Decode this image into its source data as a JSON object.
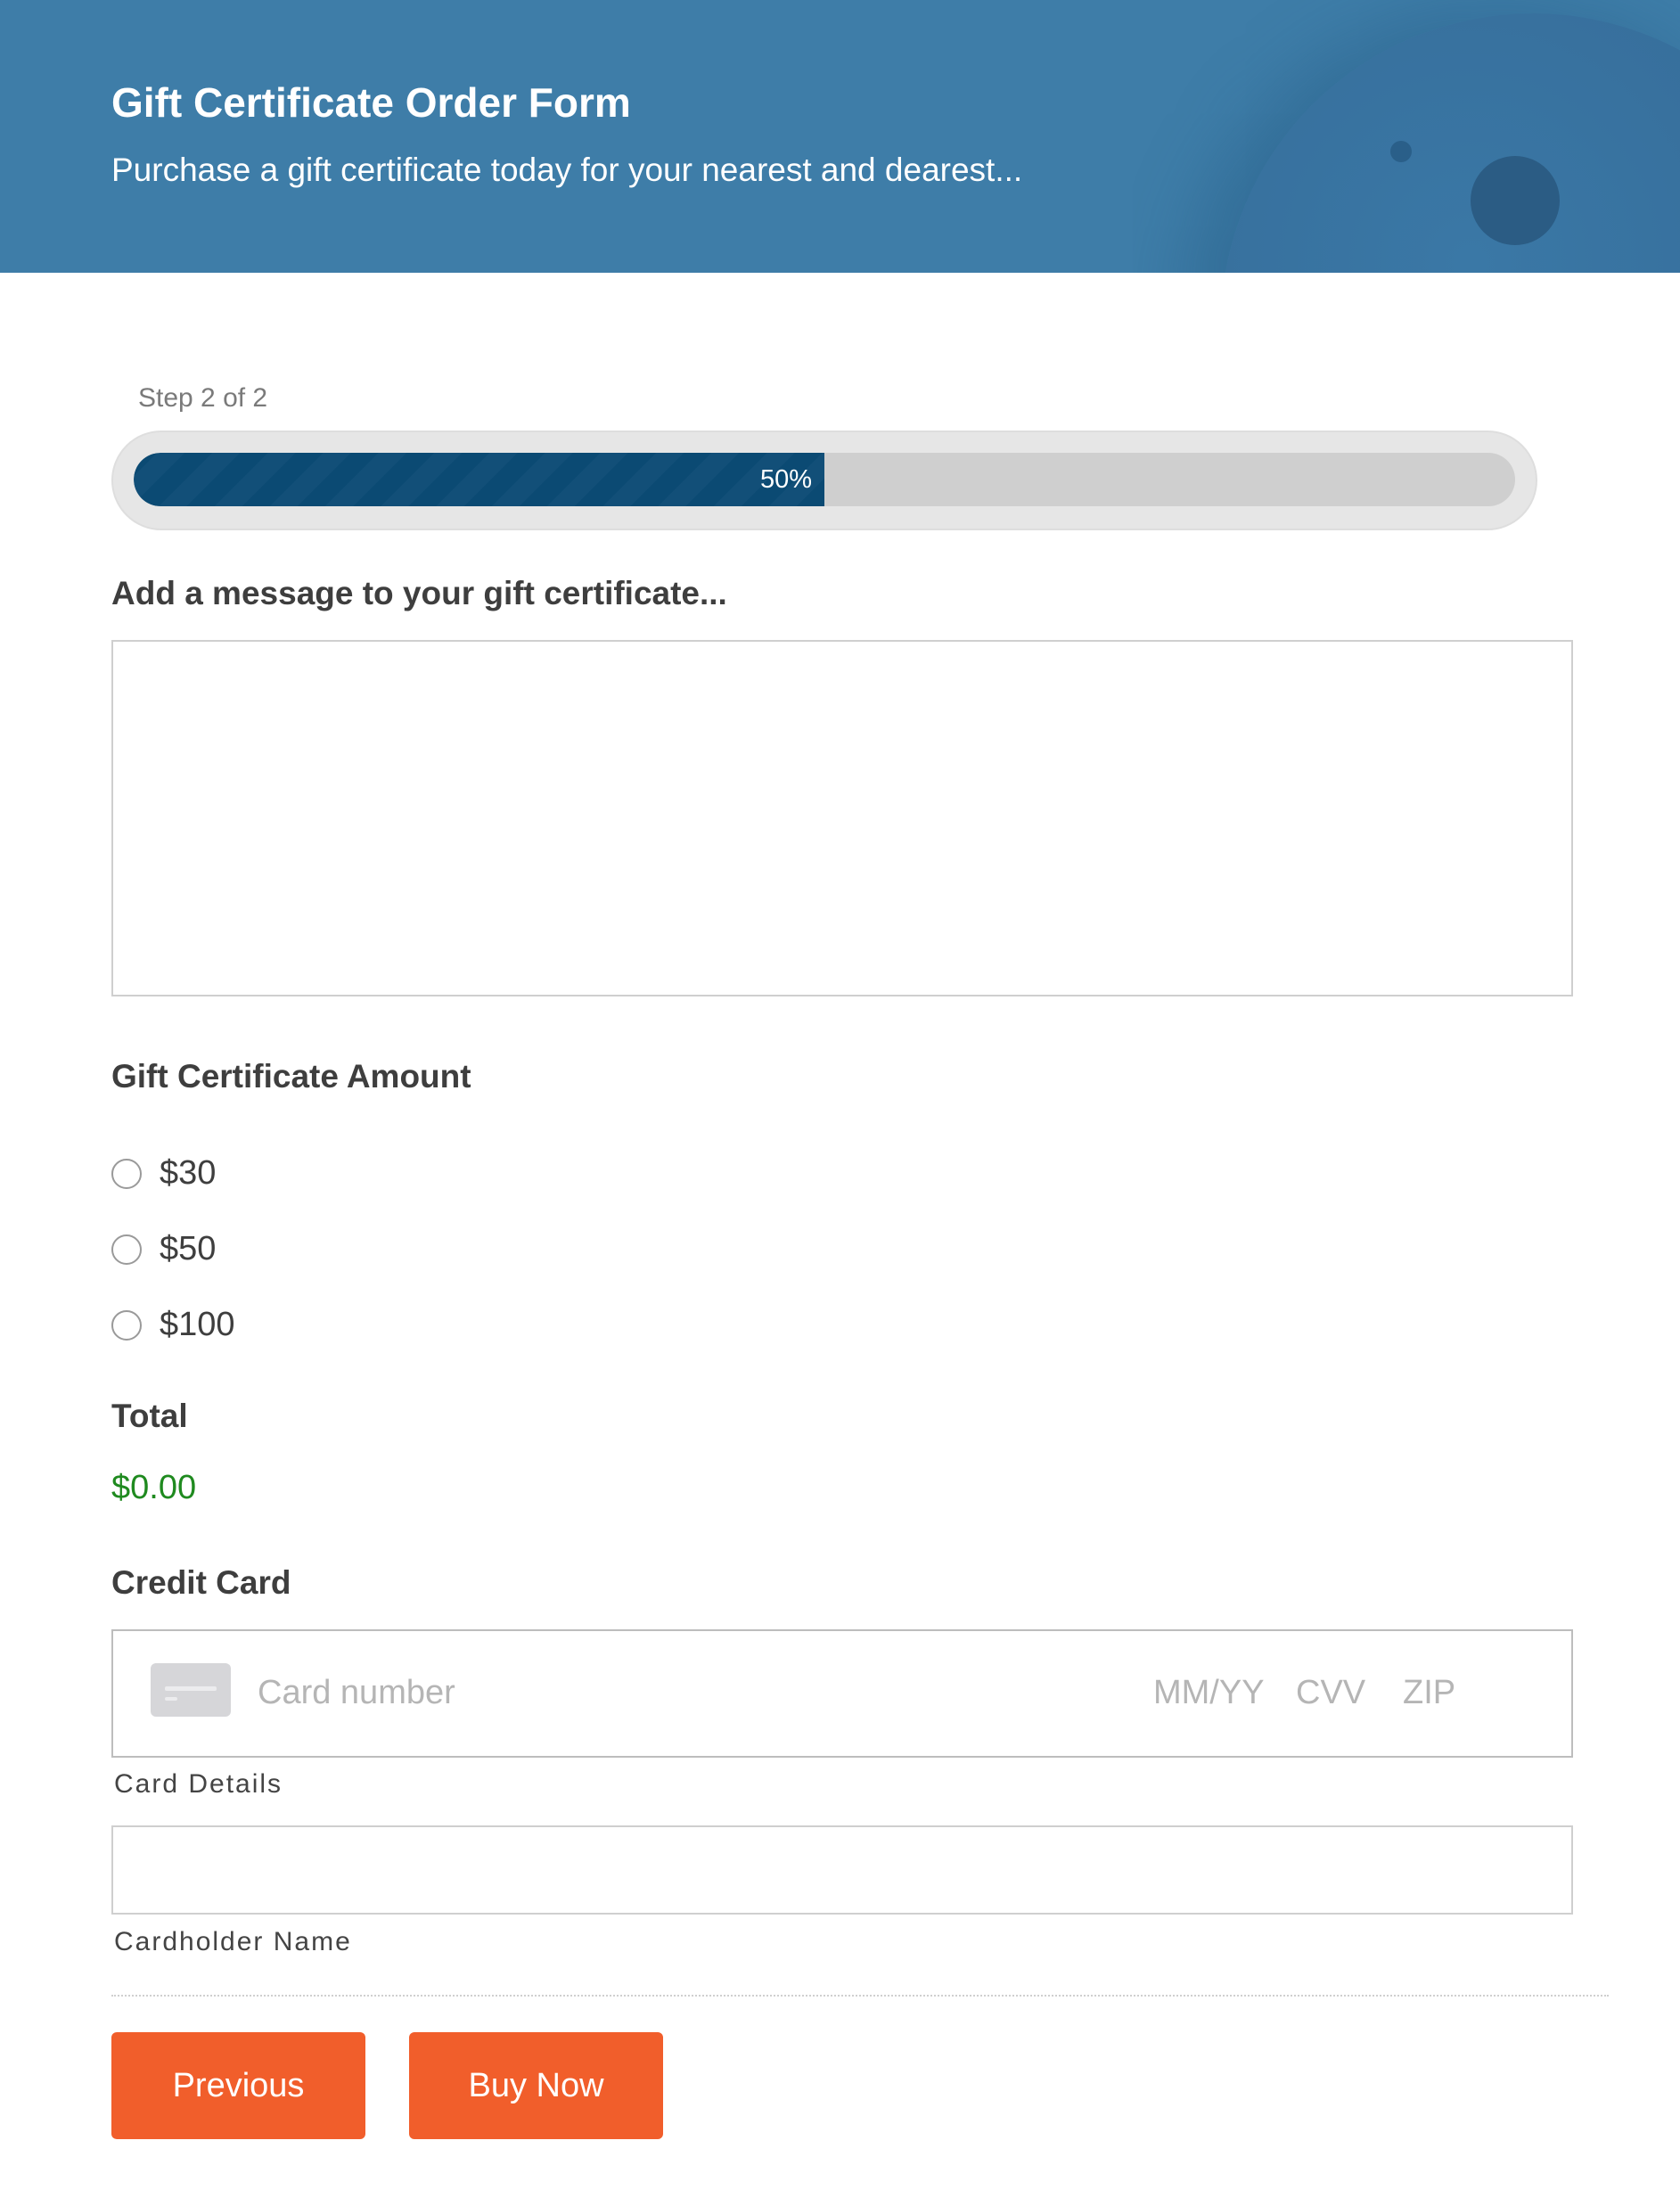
{
  "header": {
    "title": "Gift Certificate Order Form",
    "subtitle": "Purchase a gift certificate today for your nearest and dearest..."
  },
  "progress": {
    "step_label": "Step 2 of 2",
    "percent": 50,
    "percent_label": "50%"
  },
  "message": {
    "label": "Add a message to your gift certificate...",
    "value": ""
  },
  "amount": {
    "label": "Gift Certificate Amount",
    "options": [
      "$30",
      "$50",
      "$100"
    ]
  },
  "total": {
    "label": "Total",
    "value": "$0.00"
  },
  "credit_card": {
    "label": "Credit Card",
    "card_number_placeholder": "Card number",
    "expiry_placeholder": "MM/YY",
    "cvv_placeholder": "CVV",
    "zip_placeholder": "ZIP",
    "details_label": "Card Details",
    "cardholder_label": "Cardholder Name",
    "cardholder_value": ""
  },
  "buttons": {
    "previous": "Previous",
    "buy_now": "Buy Now"
  },
  "colors": {
    "header_bg": "#3e7da8",
    "progress_fill": "#0b4a73",
    "button_bg": "#f15e2b",
    "total_text": "#1f8a1f"
  }
}
